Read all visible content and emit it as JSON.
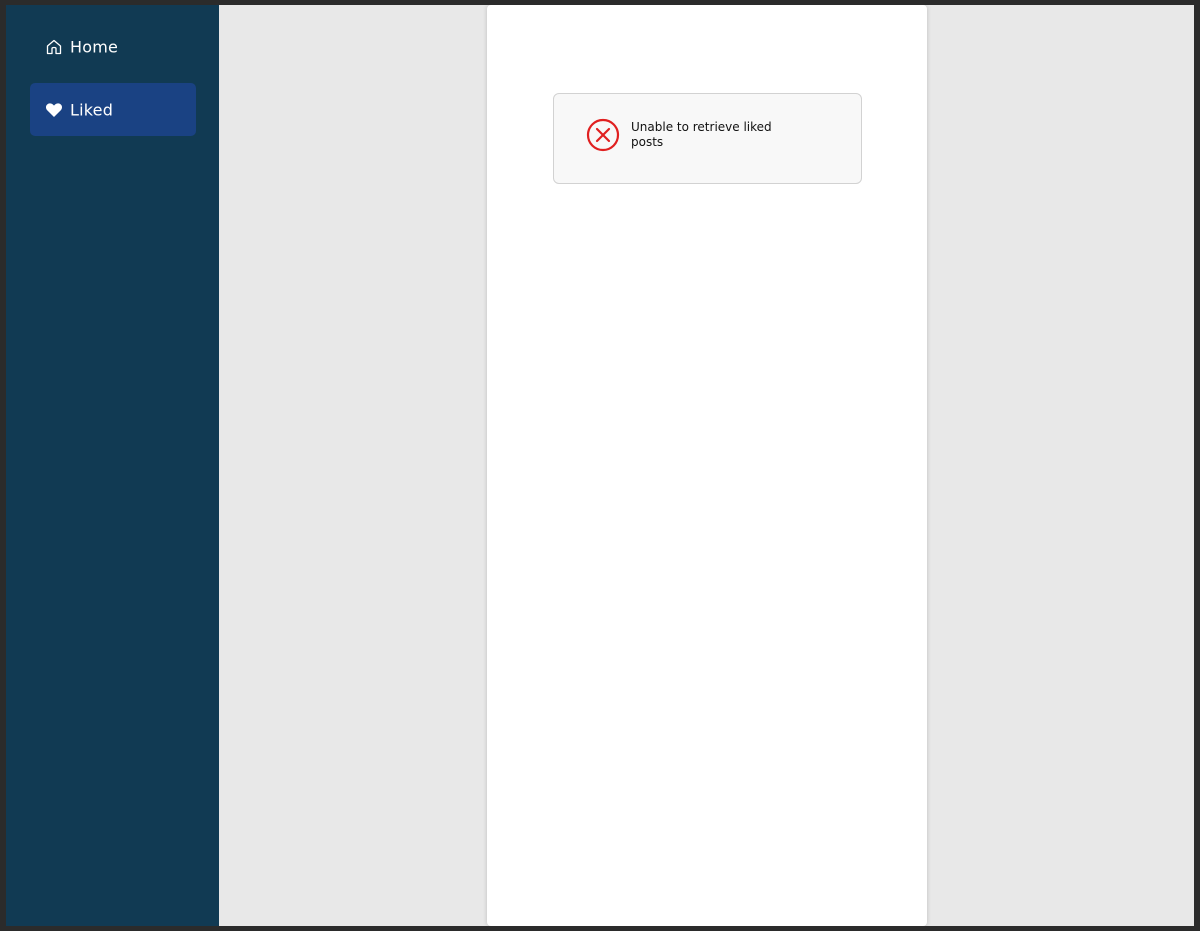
{
  "sidebar": {
    "items": [
      {
        "label": "Home",
        "icon": "home-icon",
        "active": false
      },
      {
        "label": "Liked",
        "icon": "heart-icon",
        "active": true
      }
    ]
  },
  "main": {
    "error": {
      "icon": "error-circle-x-icon",
      "message": "Unable to retrieve liked posts"
    }
  },
  "colors": {
    "sidebar_bg": "#113a53",
    "active_item_bg": "#1a4283",
    "error_icon": "#e02020",
    "page_bg": "#e8e8e8",
    "panel_bg": "#ffffff"
  }
}
